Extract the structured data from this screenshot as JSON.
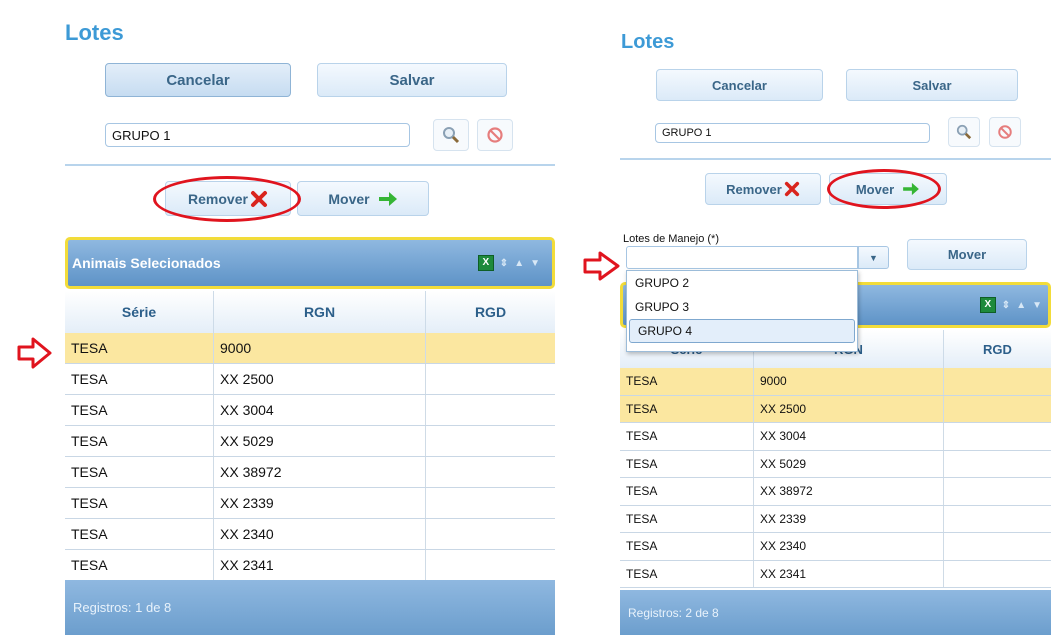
{
  "left": {
    "title": "Lotes",
    "cancel_label": "Cancelar",
    "save_label": "Salvar",
    "group_value": "GRUPO 1",
    "remove_label": "Remover",
    "move_label": "Mover",
    "grid_title": "Animais Selecionados",
    "columns": [
      "Série",
      "RGN",
      "RGD"
    ],
    "rows": [
      {
        "serie": "TESA",
        "rgn": "9000",
        "rgd": ""
      },
      {
        "serie": "TESA",
        "rgn": "XX 2500",
        "rgd": ""
      },
      {
        "serie": "TESA",
        "rgn": "XX 3004",
        "rgd": ""
      },
      {
        "serie": "TESA",
        "rgn": "XX 5029",
        "rgd": ""
      },
      {
        "serie": "TESA",
        "rgn": "XX 38972",
        "rgd": ""
      },
      {
        "serie": "TESA",
        "rgn": "XX 2339",
        "rgd": ""
      },
      {
        "serie": "TESA",
        "rgn": "XX 2340",
        "rgd": ""
      },
      {
        "serie": "TESA",
        "rgn": "XX 2341",
        "rgd": ""
      }
    ],
    "footer": "Registros: 1 de 8"
  },
  "right": {
    "title": "Lotes",
    "cancel_label": "Cancelar",
    "save_label": "Salvar",
    "group_value": "GRUPO 1",
    "remove_label": "Remover",
    "move_label": "Mover",
    "lotes_label": "Lotes de Manejo (*)",
    "lotes_value": "",
    "mover_button": "Mover",
    "dropdown_options": [
      "GRUPO 2",
      "GRUPO 3",
      "GRUPO 4"
    ],
    "columns": [
      "Série",
      "RGN",
      "RGD"
    ],
    "rows": [
      {
        "serie": "TESA",
        "rgn": "9000",
        "rgd": ""
      },
      {
        "serie": "TESA",
        "rgn": "XX 2500",
        "rgd": ""
      },
      {
        "serie": "TESA",
        "rgn": "XX 3004",
        "rgd": ""
      },
      {
        "serie": "TESA",
        "rgn": "XX 5029",
        "rgd": ""
      },
      {
        "serie": "TESA",
        "rgn": "XX 38972",
        "rgd": ""
      },
      {
        "serie": "TESA",
        "rgn": "XX 2339",
        "rgd": ""
      },
      {
        "serie": "TESA",
        "rgn": "XX 2340",
        "rgd": ""
      },
      {
        "serie": "TESA",
        "rgn": "XX 2341",
        "rgd": ""
      }
    ],
    "footer": "Registros: 2 de 8"
  },
  "colors": {
    "accent": "#3d9ad6",
    "highlight_row": "#fbe7a0",
    "annotation_red": "#e0141e",
    "grid_header": "#5e93c7"
  },
  "icons": [
    "search-icon",
    "clear-icon",
    "remove-x-icon",
    "move-arrow-icon",
    "excel-icon",
    "sort-icon",
    "chevron-up-icon",
    "chevron-down-icon",
    "red-pointer-arrow-icon"
  ]
}
